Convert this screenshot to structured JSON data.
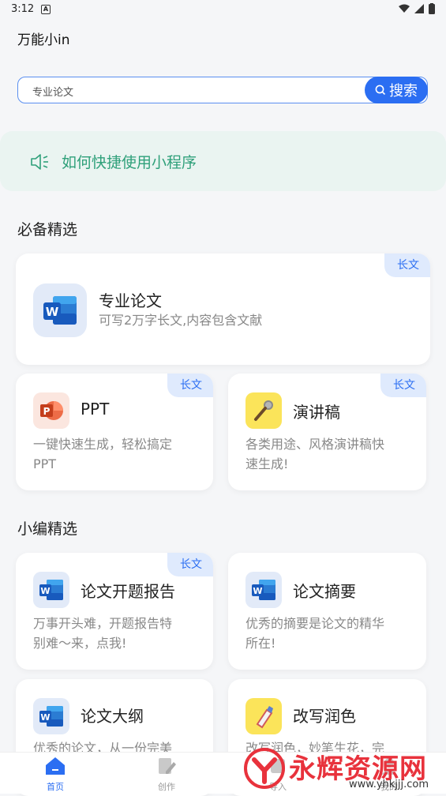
{
  "status": {
    "time": "3:12"
  },
  "app": {
    "title": "万能小in"
  },
  "search": {
    "placeholder": "专业论文",
    "button": "搜索"
  },
  "notice": {
    "text": "如何快捷使用小程序"
  },
  "sections": {
    "essential": "必备精选",
    "editor": "小编精选"
  },
  "cards": {
    "thesis": {
      "title": "专业论文",
      "desc": "可写2万字长文,内容包含文献",
      "tag": "长文"
    },
    "ppt": {
      "title": "PPT",
      "desc1": "一键快速生成，轻松搞定",
      "desc2": "PPT",
      "tag": "长文"
    },
    "speech": {
      "title": "演讲稿",
      "desc1": "各类用途、风格演讲稿快",
      "desc2": "速生成!",
      "tag": "长文"
    },
    "proposal": {
      "title": "论文开题报告",
      "desc1": "万事开头难，开题报告特",
      "desc2": "别难～来，点我!",
      "tag": "长文"
    },
    "abstract": {
      "title": "论文摘要",
      "desc1": "优秀的摘要是论文的精华",
      "desc2": "所在!"
    },
    "outline": {
      "title": "论文大纲",
      "desc1": "优秀的论文，从一份完美"
    },
    "polish": {
      "title": "改写润色",
      "desc1": "改写润色，妙笔生花，完"
    }
  },
  "tabs": [
    {
      "label": "首页"
    },
    {
      "label": "创作"
    },
    {
      "label": "导入"
    },
    {
      "label": "我的"
    }
  ],
  "watermark": {
    "text": "永辉资源网",
    "url": "www.yhkjjj.com"
  },
  "colors": {
    "accent": "#2b6ef2",
    "notice": "#2fa07a",
    "tag_bg": "#dfeafd"
  }
}
